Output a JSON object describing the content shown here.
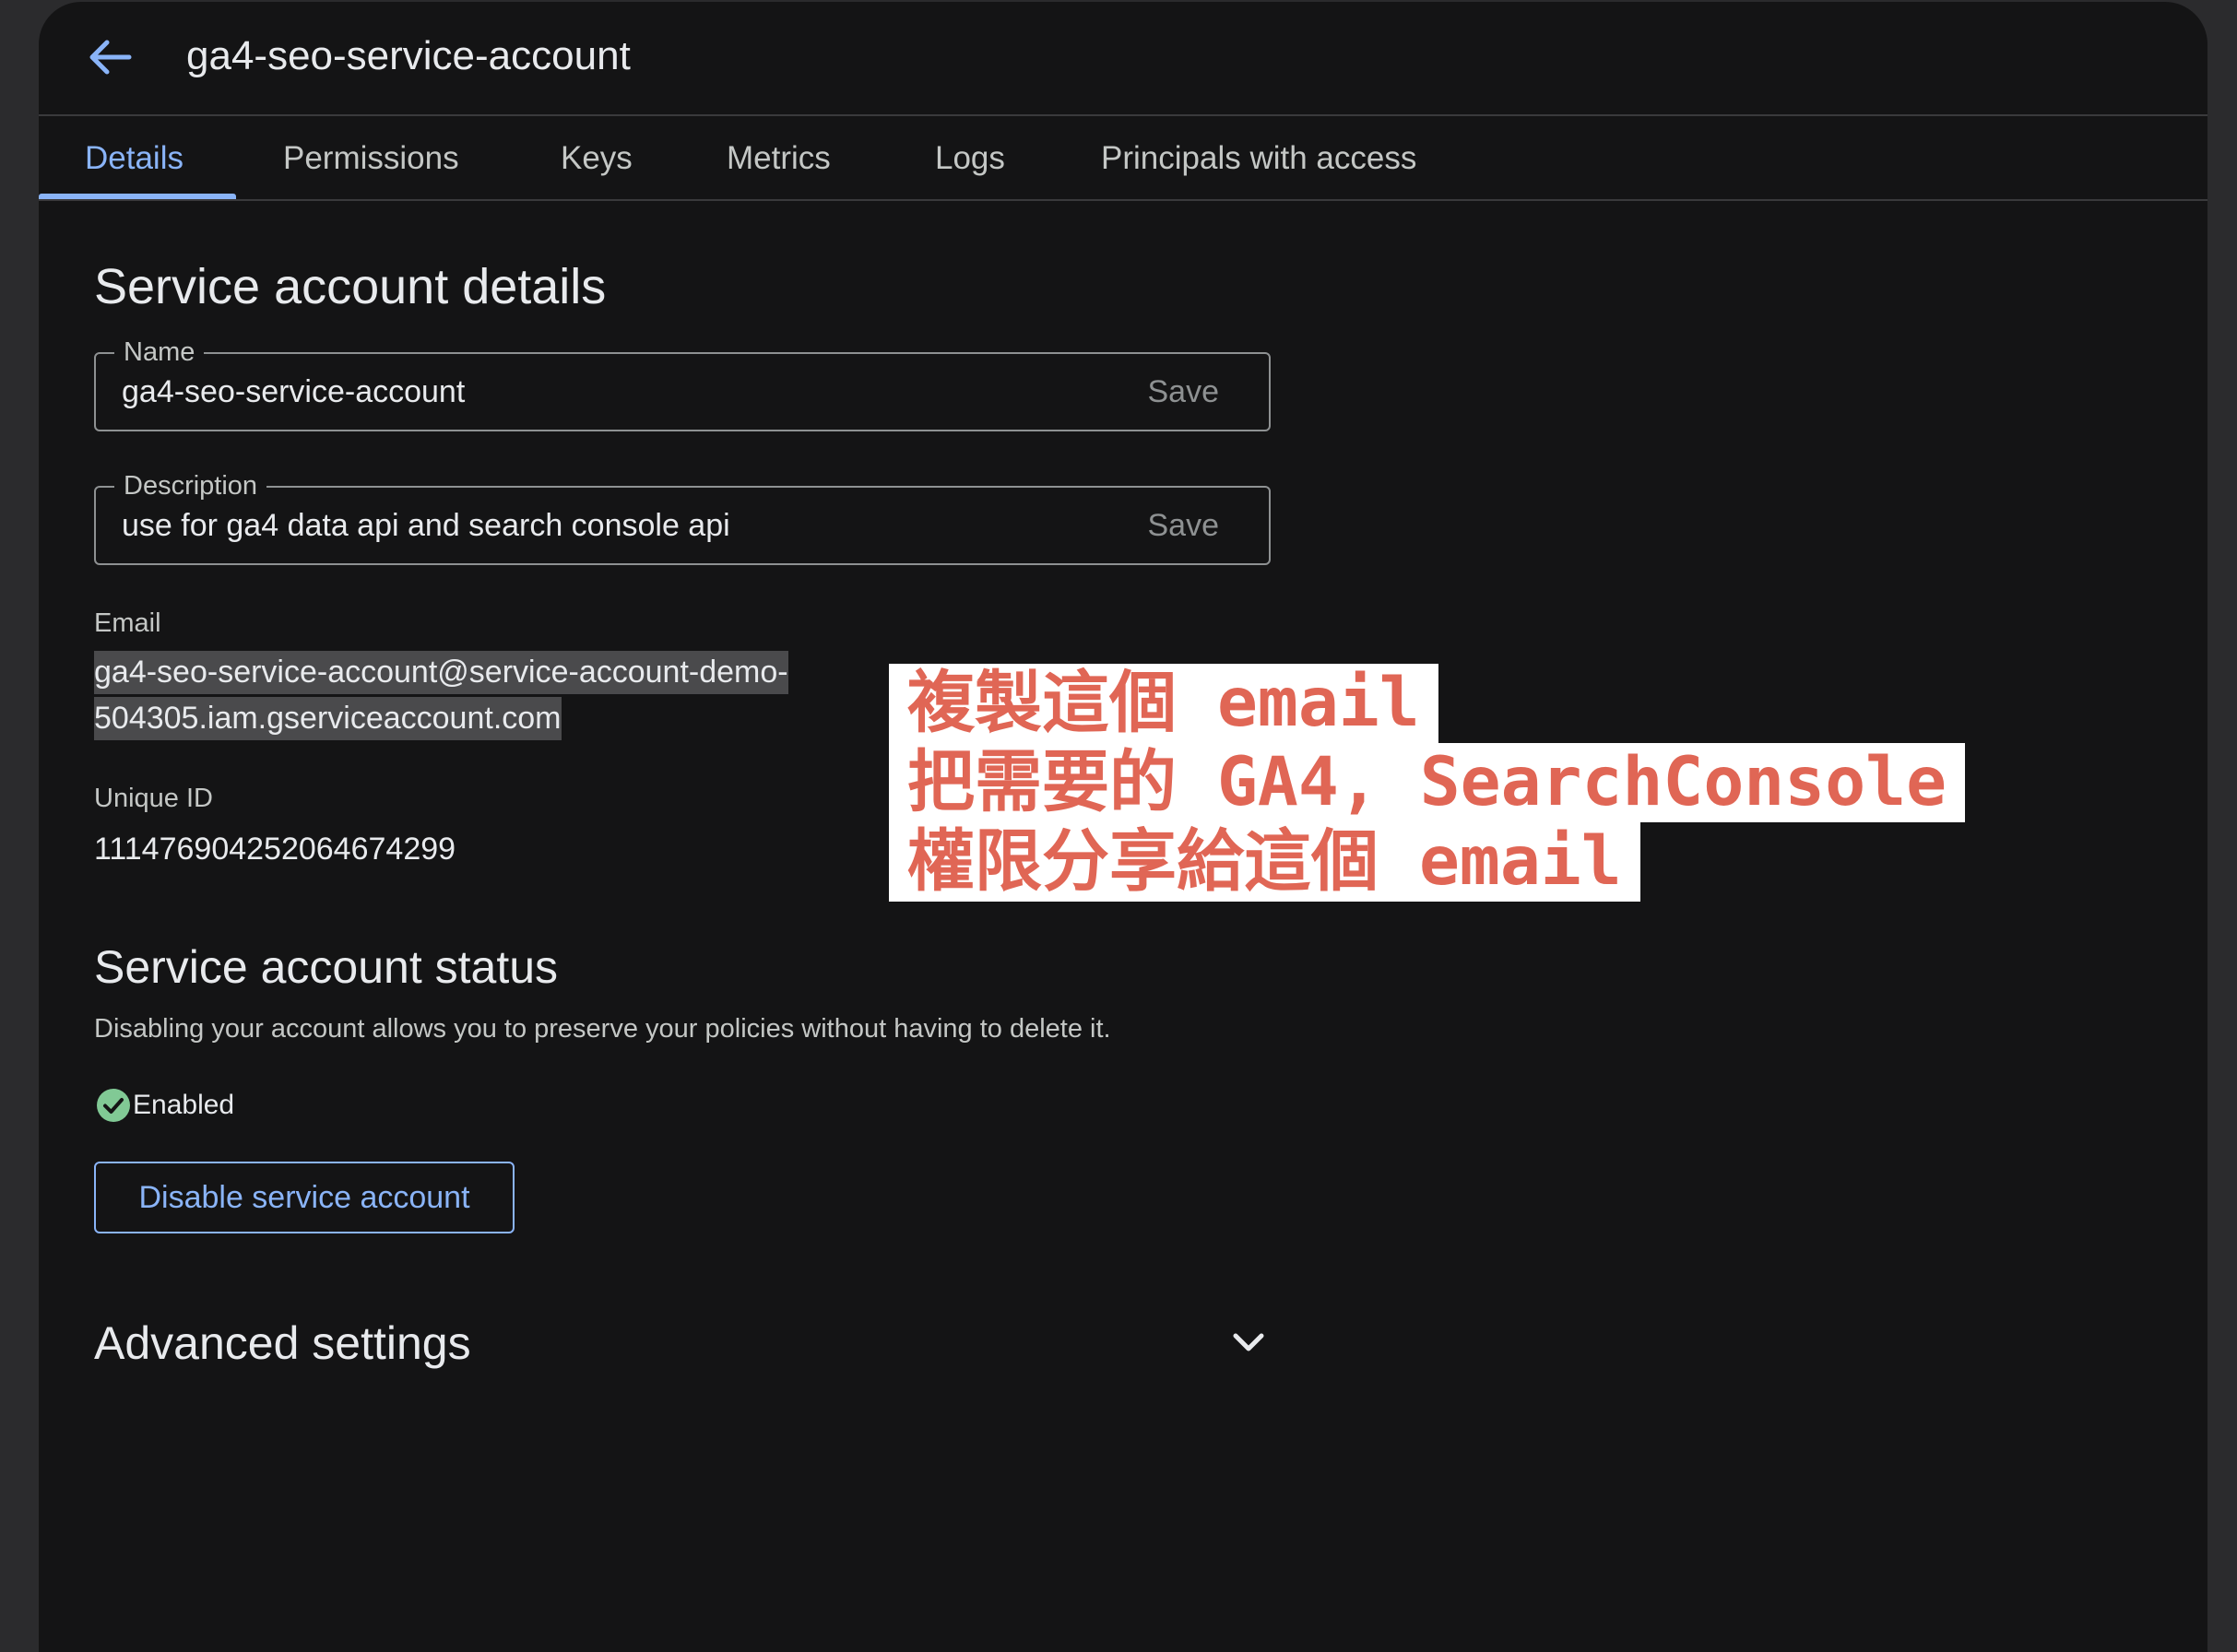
{
  "window": {
    "title": "ga4-seo-service-account"
  },
  "tabs": [
    {
      "label": "Details",
      "active": true
    },
    {
      "label": "Permissions",
      "active": false
    },
    {
      "label": "Keys",
      "active": false
    },
    {
      "label": "Metrics",
      "active": false
    },
    {
      "label": "Logs",
      "active": false
    },
    {
      "label": "Principals with access",
      "active": false
    }
  ],
  "details": {
    "heading": "Service account details",
    "name": {
      "label": "Name",
      "value": "ga4-seo-service-account",
      "save_label": "Save"
    },
    "description": {
      "label": "Description",
      "value": "use for ga4 data api and search console api",
      "save_label": "Save"
    },
    "email": {
      "label": "Email",
      "line1": "ga4-seo-service-account@service-account-demo-",
      "line2": "504305.iam.gserviceaccount.com"
    },
    "unique_id": {
      "label": "Unique ID",
      "value": "111476904252064674299"
    }
  },
  "status": {
    "heading": "Service account status",
    "description": "Disabling your account allows you to preserve your policies without having to delete it.",
    "state": "Enabled",
    "disable_button": "Disable service account"
  },
  "advanced": {
    "heading": "Advanced settings"
  },
  "annotation": {
    "lines": [
      "複製這個 email",
      "把需要的 GA4, SearchConsole",
      "權限分享給這個 email"
    ]
  },
  "colors": {
    "accent": "#8ab4f8",
    "success": "#81c995",
    "annotation_text": "#e06655",
    "background": "#141415"
  },
  "icons": {
    "back": "arrow-back-icon",
    "status": "check-circle-icon",
    "expand": "chevron-down-icon"
  }
}
